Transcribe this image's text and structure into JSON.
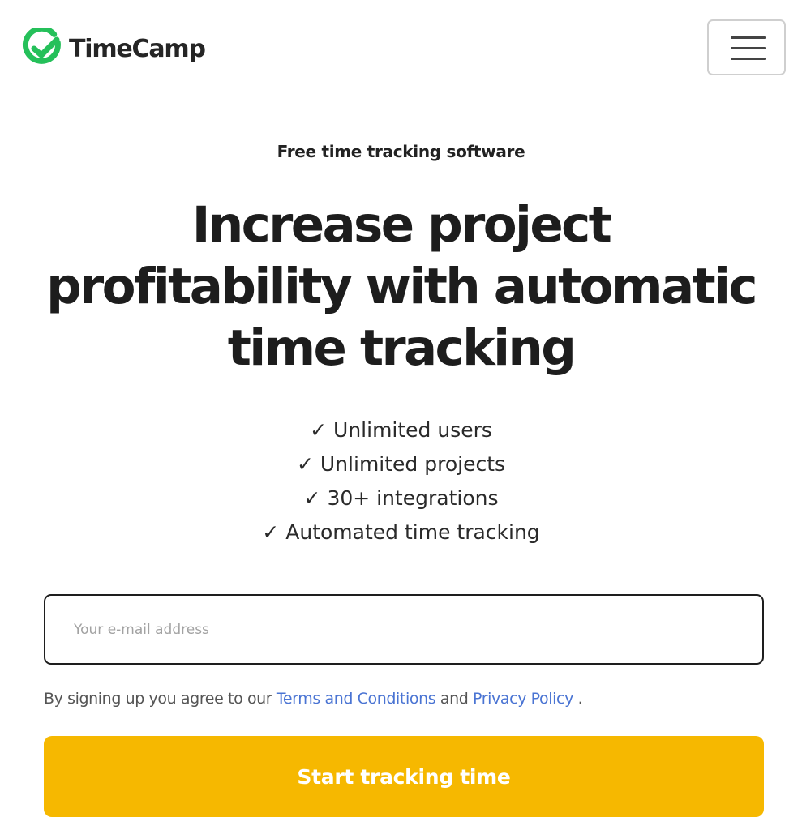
{
  "header": {
    "brand_name": "TimeCamp",
    "logo_icon": "timecamp-check-logo-icon",
    "menu_icon": "hamburger-menu-icon"
  },
  "hero": {
    "eyebrow": "Free time tracking software",
    "headline_lines": [
      "Increase project",
      "profitability with automatic",
      "time tracking"
    ],
    "check_glyph": "✓",
    "features": [
      "Unlimited users",
      "Unlimited projects",
      "30+ integrations",
      "Automated time tracking"
    ]
  },
  "signup": {
    "email_placeholder": "Your e-mail address",
    "email_value": "",
    "terms_prefix": "By signing up you agree to our",
    "terms_link": "Terms and Conditions",
    "terms_and": "and",
    "privacy_link": "Privacy Policy",
    "terms_suffix": ".",
    "cta_label": "Start tracking time"
  },
  "colors": {
    "brand_green": "#25c05a",
    "cta_yellow": "#f6b800",
    "link_blue": "#4a74d3",
    "heading": "#1d1d1d"
  }
}
